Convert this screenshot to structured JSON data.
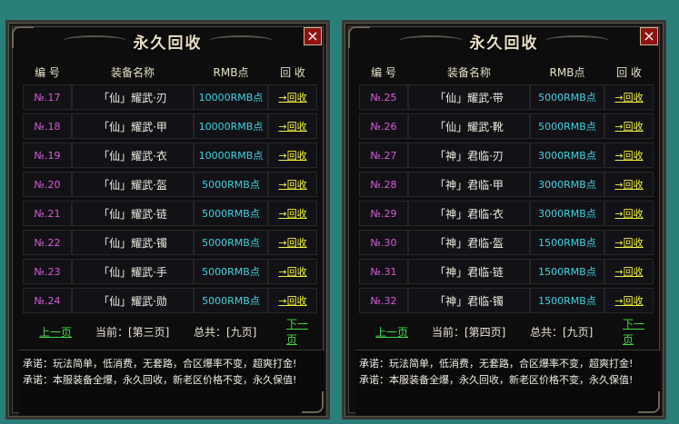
{
  "colors": {
    "background": "#2a7f7a",
    "panel": "#0d0d0e",
    "number": "#d85ad6",
    "price": "#3fd2df",
    "action": "#f2f23c",
    "pager_link": "#3fdd3f"
  },
  "panels": [
    {
      "title": "永久回收",
      "close": "×",
      "headers": {
        "no": "编 号",
        "name": "装备名称",
        "price": "RMB点",
        "action": "回 收"
      },
      "rows": [
        {
          "no": "№.17",
          "name": "「仙」耀武·刃",
          "price": "10000RMB点",
          "action": "→回收"
        },
        {
          "no": "№.18",
          "name": "「仙」耀武·甲",
          "price": "10000RMB点",
          "action": "→回收"
        },
        {
          "no": "№.19",
          "name": "「仙」耀武·衣",
          "price": "10000RMB点",
          "action": "→回收"
        },
        {
          "no": "№.20",
          "name": "「仙」耀武·盔",
          "price": "5000RMB点",
          "action": "→回收"
        },
        {
          "no": "№.21",
          "name": "「仙」耀武·链",
          "price": "5000RMB点",
          "action": "→回收"
        },
        {
          "no": "№.22",
          "name": "「仙」耀武·镯",
          "price": "5000RMB点",
          "action": "→回收"
        },
        {
          "no": "№.23",
          "name": "「仙」耀武·手",
          "price": "5000RMB点",
          "action": "→回收"
        },
        {
          "no": "№.24",
          "name": "「仙」耀武·勋",
          "price": "5000RMB点",
          "action": "→回收"
        }
      ],
      "pager": {
        "prev": "上一页",
        "current": "当前：[第三页]",
        "total": "总共：[九页]",
        "next": "下一页"
      },
      "notes": [
        "承诺：玩法简单，低消费，无套路，合区爆率不变，超爽打金!",
        "承诺：本服装备全爆，永久回收，新老区价格不变，永久保值!"
      ]
    },
    {
      "title": "永久回收",
      "close": "×",
      "headers": {
        "no": "编 号",
        "name": "装备名称",
        "price": "RMB点",
        "action": "回 收"
      },
      "rows": [
        {
          "no": "№.25",
          "name": "「仙」耀武·带",
          "price": "5000RMB点",
          "action": "→回收"
        },
        {
          "no": "№.26",
          "name": "「仙」耀武·靴",
          "price": "5000RMB点",
          "action": "→回收"
        },
        {
          "no": "№.27",
          "name": "「神」君临·刃",
          "price": "3000RMB点",
          "action": "→回收"
        },
        {
          "no": "№.28",
          "name": "「神」君临·甲",
          "price": "3000RMB点",
          "action": "→回收"
        },
        {
          "no": "№.29",
          "name": "「神」君临·衣",
          "price": "3000RMB点",
          "action": "→回收"
        },
        {
          "no": "№.30",
          "name": "「神」君临·盔",
          "price": "1500RMB点",
          "action": "→回收"
        },
        {
          "no": "№.31",
          "name": "「神」君临·链",
          "price": "1500RMB点",
          "action": "→回收"
        },
        {
          "no": "№.32",
          "name": "「神」君临·镯",
          "price": "1500RMB点",
          "action": "→回收"
        }
      ],
      "pager": {
        "prev": "上一页",
        "current": "当前：[第四页]",
        "total": "总共：[九页]",
        "next": "下一页"
      },
      "notes": [
        "承诺：玩法简单，低消费，无套路，合区爆率不变，超爽打金!",
        "承诺：本服装备全爆，永久回收，新老区价格不变，永久保值!"
      ]
    }
  ]
}
